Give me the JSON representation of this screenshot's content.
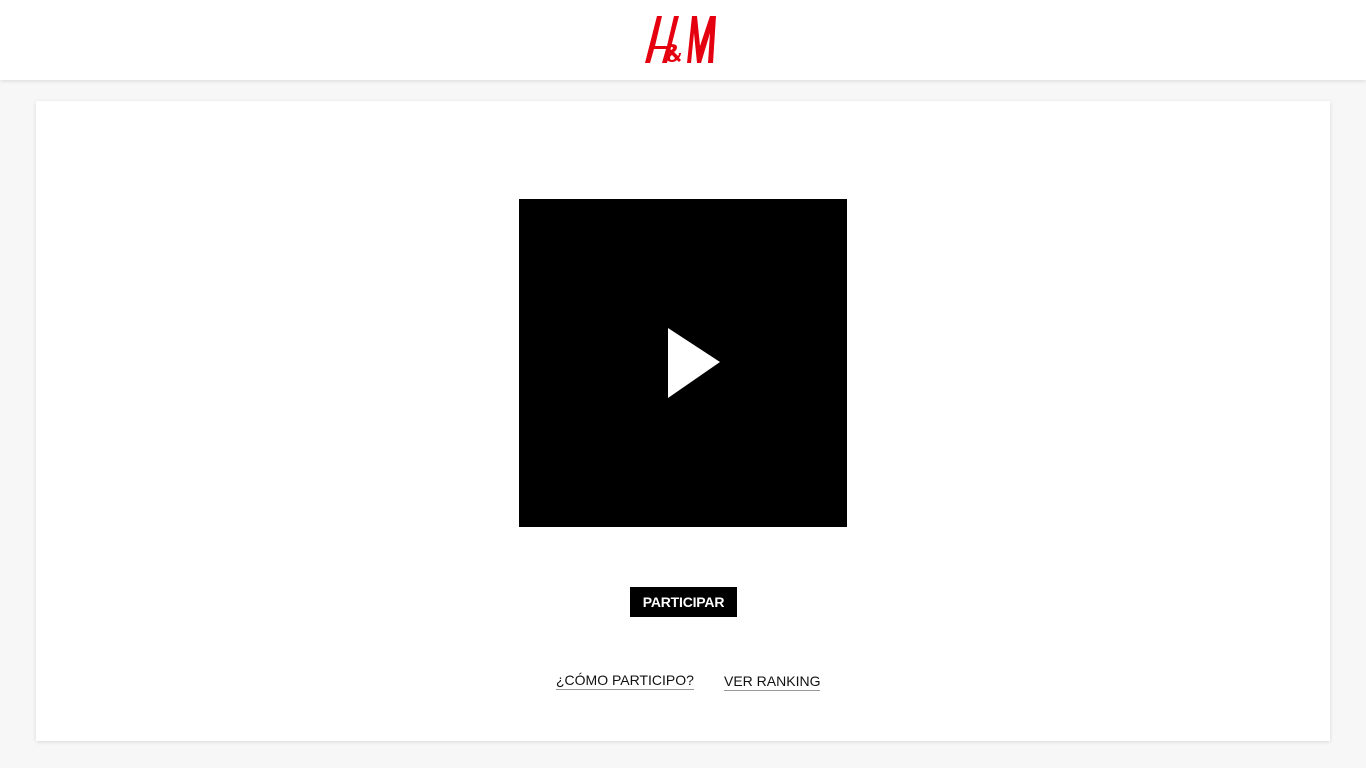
{
  "header": {
    "brand_name": "H&M",
    "logo_icon": "hm-logo-icon",
    "brand_color": "#e50010"
  },
  "video": {
    "play_icon": "play-icon",
    "background_color": "#000000"
  },
  "actions": {
    "participate_label": "PARTICIPAR",
    "how_to_label": "¿CÓMO PARTICIPO?",
    "ranking_label": "VER RANKING"
  }
}
